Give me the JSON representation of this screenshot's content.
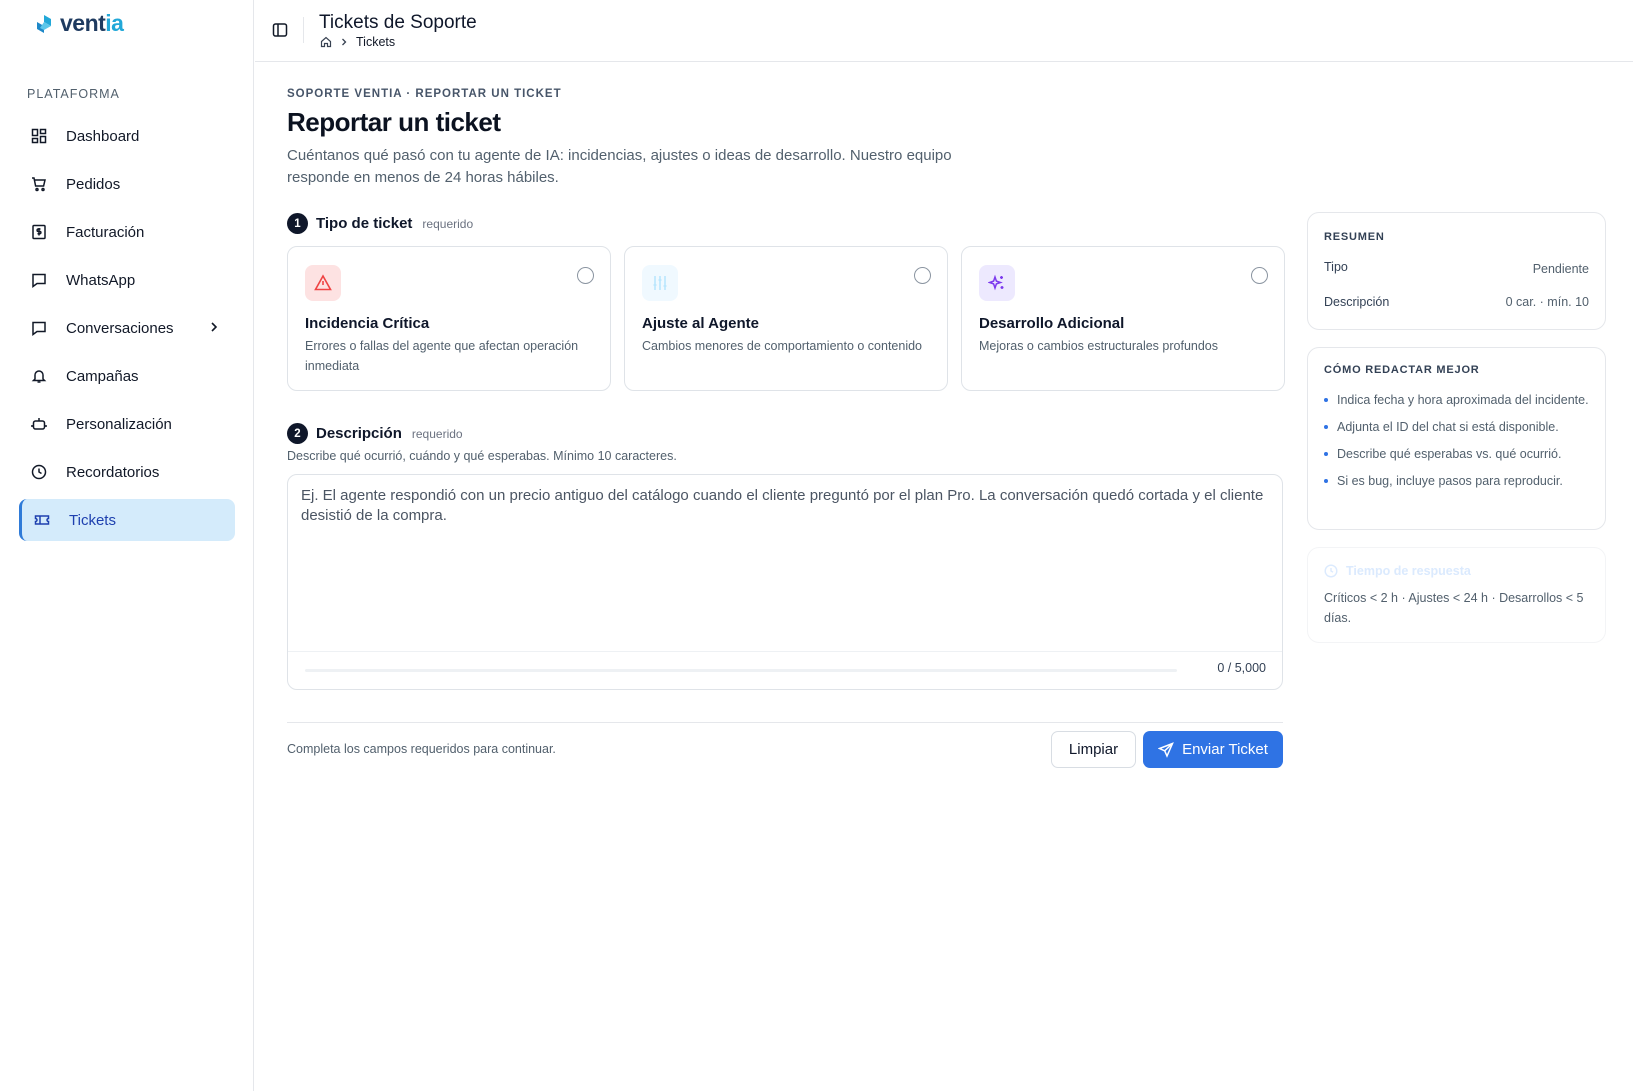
{
  "brand": {
    "name_main": "vent",
    "name_accent": "ia"
  },
  "sidebar": {
    "section_label": "PLATAFORMA",
    "items": [
      {
        "label": "Dashboard",
        "icon": "dashboard-icon"
      },
      {
        "label": "Pedidos",
        "icon": "cart-icon"
      },
      {
        "label": "Facturación",
        "icon": "invoice-icon"
      },
      {
        "label": "WhatsApp",
        "icon": "chat-icon"
      },
      {
        "label": "Conversaciones",
        "icon": "chat-icon"
      },
      {
        "label": "Campañas",
        "icon": "bell-icon"
      },
      {
        "label": "Personalización",
        "icon": "robot-icon"
      },
      {
        "label": "Recordatorios",
        "icon": "clock-icon"
      },
      {
        "label": "Tickets",
        "icon": "ticket-icon",
        "active": true
      }
    ]
  },
  "header": {
    "title": "Tickets de Soporte",
    "breadcrumb": [
      "Tickets"
    ]
  },
  "main": {
    "eyebrow": "SOPORTE VENTIA · REPORTAR UN TICKET",
    "title": "Reportar un ticket",
    "lead": "Cuéntanos qué pasó con tu agente de IA: incidencias, ajustes o ideas de desarrollo. Nuestro equipo responde en menos de 24 horas hábiles.",
    "step1": {
      "num": "1",
      "title": "Tipo de ticket",
      "required": "requerido"
    },
    "types": [
      {
        "title": "Incidencia Crítica",
        "desc": "Errores o fallas del agente que afectan operación inmediata",
        "icon": "alert-triangle-icon",
        "color": "#ef4444"
      },
      {
        "title": "Ajuste al Agente",
        "desc": "Cambios menores de comportamiento o contenido",
        "icon": "sliders-icon",
        "color": "#bae6fd"
      },
      {
        "title": "Desarrollo Adicional",
        "desc": "Mejoras o cambios estructurales profundos",
        "icon": "sparkles-icon",
        "color": "#7c3aed"
      }
    ],
    "step2": {
      "num": "2",
      "title": "Descripción",
      "required": "requerido"
    },
    "desc_help": "Describe qué ocurrió, cuándo y qué esperabas. Mínimo 10 caracteres.",
    "textarea": {
      "value": "",
      "placeholder": "Ej. El agente respondió con un precio antiguo del catálogo cuando el cliente preguntó por el plan Pro. La conversación quedó cortada y el cliente desistió de la compra.",
      "counter": "0 / 5,000",
      "progress": 0
    },
    "hint": "Completa los campos requeridos para continuar.",
    "clear_label": "Limpiar",
    "send_label": "Enviar Ticket"
  },
  "summary": {
    "title": "RESUMEN",
    "rows": [
      {
        "label": "Tipo",
        "value": "Pendiente"
      },
      {
        "label": "Descripción",
        "value": "0 car. · mín. 10"
      }
    ]
  },
  "tips": {
    "title": "CÓMO REDACTAR MEJOR",
    "items": [
      "Indica fecha y hora aproximada del incidente.",
      "Adjunta el ID del chat si está disponible.",
      "Describe qué esperabas vs. qué ocurrió.",
      "Si es bug, incluye pasos para reproducir."
    ]
  },
  "response": {
    "title": "Tiempo de respuesta",
    "body": "Críticos < 2 h · Ajustes < 24 h · Desarrollos < 5 días."
  },
  "colors": {
    "accent": "#2f73e4",
    "active_bg": "#d4ebfb",
    "brand_dark": "#1e3a5f",
    "brand_light": "#22a8d8"
  }
}
